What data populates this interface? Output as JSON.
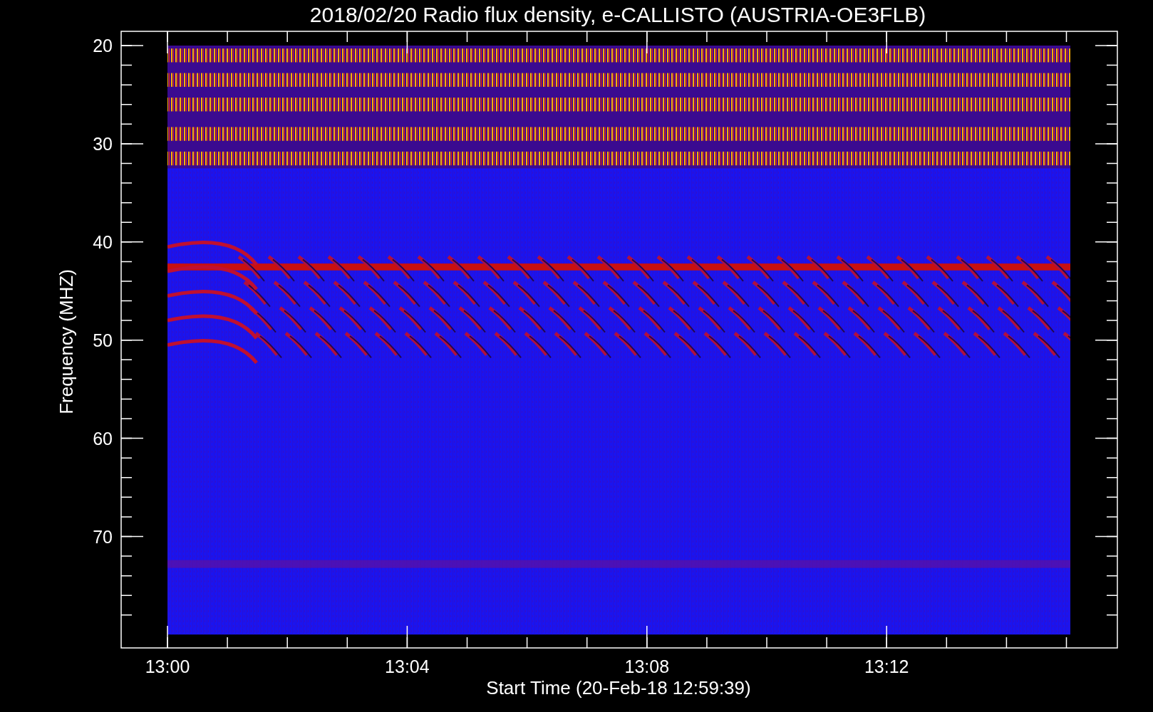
{
  "title": "2018/02/20  Radio flux density, e-CALLISTO (AUSTRIA-OE3FLB)",
  "ylabel": "Frequency (MHZ)",
  "xlabel": "Start Time (20-Feb-18 12:59:39)",
  "yticks": [
    "20",
    "30",
    "40",
    "50",
    "60",
    "70"
  ],
  "xticks": [
    "13:00",
    "13:04",
    "13:08",
    "13:12"
  ]
}
